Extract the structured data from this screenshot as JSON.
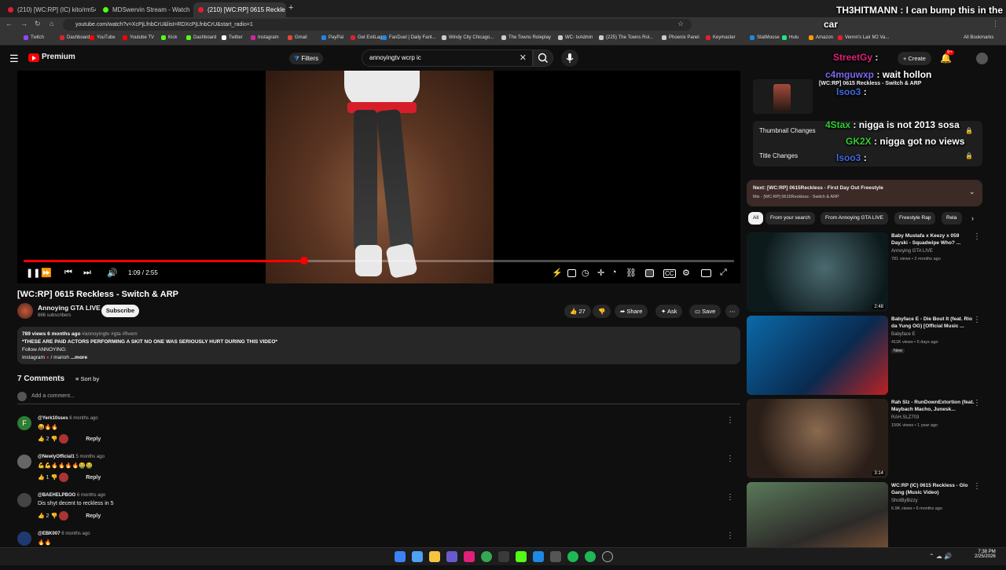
{
  "browser": {
    "tabs": [
      {
        "label": "(210) [WC:RP] (IC) kito/rm54th",
        "active": false,
        "color": "#e02030"
      },
      {
        "label": "MDSwervin Stream - Watch Li",
        "active": false,
        "color": "#53fc18"
      },
      {
        "label": "(210) [WC:RP] 0615 Reckle",
        "active": true,
        "color": "#e02030"
      }
    ],
    "new_tab": "+",
    "url": "youtube.com/watch?v=XcPjLfnbCrU&list=RDXcPjLfnbCrU&start_radio=1",
    "bookmarks": [
      {
        "label": "Twitch",
        "color": "#9146ff"
      },
      {
        "label": "Dashboard",
        "color": "#e02030"
      },
      {
        "label": "YouTube",
        "color": "#ff0000"
      },
      {
        "label": "Youtube TV",
        "color": "#ff0000"
      },
      {
        "label": "Kick",
        "color": "#53fc18"
      },
      {
        "label": "Dashboard",
        "color": "#53fc18"
      },
      {
        "label": "Twitter",
        "color": "#ffffff"
      },
      {
        "label": "Instagram",
        "color": "#d6249f"
      },
      {
        "label": "Gmail",
        "color": "#ea4335"
      },
      {
        "label": "PayPal",
        "color": "#1e88e5"
      },
      {
        "label": "Get ExitLag",
        "color": "#e02030"
      },
      {
        "label": "FanDuel | Daily Fant...",
        "color": "#1e88e5"
      },
      {
        "label": "Windy City Chicago...",
        "color": "#cccccc"
      },
      {
        "label": "The Towns Roleplay",
        "color": "#cccccc"
      },
      {
        "label": "WC- txAdmin",
        "color": "#cccccc"
      },
      {
        "label": "(225) The Towns Rol...",
        "color": "#cccccc"
      },
      {
        "label": "Phoenix Panel",
        "color": "#cccccc"
      },
      {
        "label": "Keymaster",
        "color": "#e02030"
      },
      {
        "label": "StatMouse",
        "color": "#1e88e5"
      },
      {
        "label": "Hulu",
        "color": "#1ce783"
      },
      {
        "label": "Amazon",
        "color": "#ff9900"
      },
      {
        "label": "Vennn's Lair M2 Va...",
        "color": "#e02030"
      }
    ],
    "all_bookmarks": "All Bookmarks"
  },
  "youtube": {
    "logo": "Premium",
    "filters": "Filters",
    "search_value": "annoyingtv wcrp ic",
    "create": "Create",
    "notif_count": "9+",
    "video": {
      "time": "1:09 / 2:55",
      "progress": 0.395,
      "title": "[WC:RP] 0615 Reckless - Switch & ARP",
      "channel": "Annoying GTA LIVE",
      "subs": "666 subscribers",
      "subscribe": "Subscribe",
      "likes": "27",
      "share": "Share",
      "ask": "Ask",
      "save": "Save",
      "views_age": "789 views  6 months ago",
      "tags": "#annoyingtv #gta #fivem",
      "desc_line1": "*THESE ARE PAID ACTORS PERFORMING A SKIT NO ONE WAS SERIOUSLY HURT DURING THIS VIDEO*",
      "desc_line2": "Follow ANNOYING:",
      "desc_line3": "Instagram",
      "desc_line3b": " /  marioh",
      "more": "...more"
    },
    "comments": {
      "heading": "7 Comments",
      "sort": "Sort by",
      "add": "Add a comment...",
      "reply": "Reply",
      "items": [
        {
          "user": "@Yerk10sses",
          "age": "6 months ago",
          "text": "😝🔥🔥",
          "likes": "2",
          "avatar": "F",
          "color": "#2e7d32"
        },
        {
          "user": "@NewlyOfficial1",
          "age": "5 months ago",
          "text": "💪💪🔥🔥🔥🔥🤮🤮",
          "likes": "1",
          "avatar": "",
          "color": "#666666"
        },
        {
          "user": "@BAEHELPBOO",
          "age": "6 months ago",
          "text": "Dis shyt decent to reckless in 5",
          "likes": "2",
          "avatar": "",
          "color": "#444444"
        },
        {
          "user": "@EBK007",
          "age": "6 months ago",
          "text": "🔥🔥",
          "likes": "",
          "avatar": "",
          "color": "#1e3a70"
        }
      ]
    },
    "side": {
      "thumbnail_changes": "Thumbnail Changes",
      "title_changes": "Title Changes",
      "mini_title": "[WC:RP] 0615 Reckless - Switch & ARP",
      "upnext_title": "Next: [WC:RP] 0615Reckless - First Day Out Freestyle",
      "upnext_sub": "Mix - [WC:RP] 0615Reckless - Switch & ARP",
      "chips": [
        "All",
        "From your search",
        "From Annoying GTA LIVE",
        "Freestyle Rap",
        "Rela"
      ],
      "recs": [
        {
          "title": "Baby Mustafa x Keezy x 059 Dayski - Squadwipe Who? ...",
          "channel": "Annoying GTA LIVE",
          "meta": "781 views • 2 months ago",
          "dur": "2:48",
          "new": ""
        },
        {
          "title": "Babyface E - Die Bout It (feat. Rio da Yung OG) [Official Music ...",
          "channel": "Babyface E",
          "meta": "411K views • 5 days ago",
          "dur": "",
          "new": "New"
        },
        {
          "title": "Rah Slz - RunDownExtortion (feat. Maybach Macho, Junesk...",
          "channel": "RAH.SLZ703",
          "meta": "150K views • 1 year ago",
          "dur": "3:14",
          "new": ""
        },
        {
          "title": "WC:RP (IC) 0615 Reckless - Glo Gang (Music Video)",
          "channel": "ShotByBizzy",
          "meta": "6.9K views • 6 months ago",
          "dur": "",
          "new": ""
        }
      ]
    }
  },
  "chat": [
    {
      "user": "TH3HITMANN",
      "msg": ": I can bump this in the",
      "user_color": "#ffffff"
    },
    {
      "user": "",
      "msg": "car",
      "user_color": "#ffffff"
    },
    {
      "user": "StreetGy",
      "msg": ":",
      "user_color": "#e0207a"
    },
    {
      "user": "c4mguwxp",
      "msg": ": wait hollon",
      "user_color": "#7b68ee"
    },
    {
      "user": "lsoo3",
      "msg": ":",
      "user_color": "#4169e1"
    },
    {
      "user": "4Stax",
      "msg": ": nigga is not 2013 sosa",
      "user_color": "#32cd32"
    },
    {
      "user": "GK2X",
      "msg": ": nigga got no views",
      "user_color": "#32cd32"
    },
    {
      "user": "lsoo3",
      "msg": ":",
      "user_color": "#4169e1"
    }
  ],
  "taskbar": {
    "time": "7:38 PM",
    "date": "2/25/2026"
  }
}
